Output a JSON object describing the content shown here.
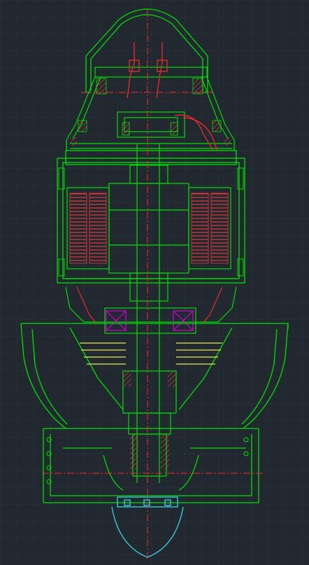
{
  "app": {
    "window_title": ""
  },
  "colors": {
    "background": "#212830",
    "grid": "#2b3440",
    "outline": "#00e000",
    "section_hatch": "#e03a3a",
    "centerline": "#ff2a2a",
    "bearing": "#d400d4",
    "cooling_fins": "#e8e850",
    "nose_cone": "#39d4e8"
  },
  "drawing": {
    "view": "cross-section",
    "grid_visible": true,
    "icons": [
      "centerline",
      "hatching",
      "bearing-cross",
      "stator-winding",
      "fan-blade"
    ]
  }
}
